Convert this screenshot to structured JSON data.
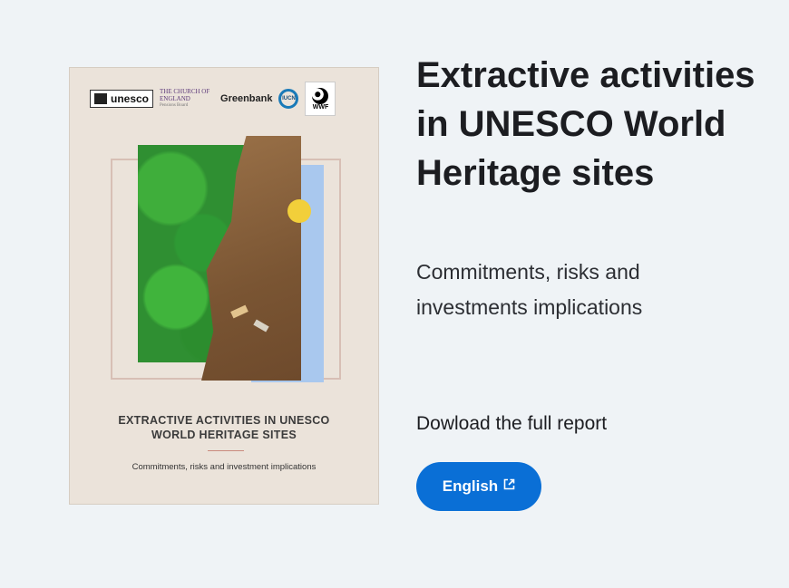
{
  "cover": {
    "logos": {
      "unesco": "unesco",
      "church": "THE CHURCH OF ENGLAND",
      "church_sub": "Pensions Board",
      "greenbank": "Greenbank",
      "iucn": "IUCN",
      "wwf": "WWF"
    },
    "title_line1": "EXTRACTIVE ACTIVITIES IN UNESCO",
    "title_line2": "WORLD HERITAGE SITES",
    "subtitle": "Commitments, risks and investment implications"
  },
  "main": {
    "title": "Extractive activities in UNESCO World Heritage sites",
    "subtitle": "Commitments, risks and investments implications",
    "download_label": "Dowload the full report",
    "button_label": "English",
    "button_icon": "external-link-icon"
  },
  "colors": {
    "background": "#eff3f6",
    "button": "#0a6fd6",
    "text": "#1c1d21"
  }
}
